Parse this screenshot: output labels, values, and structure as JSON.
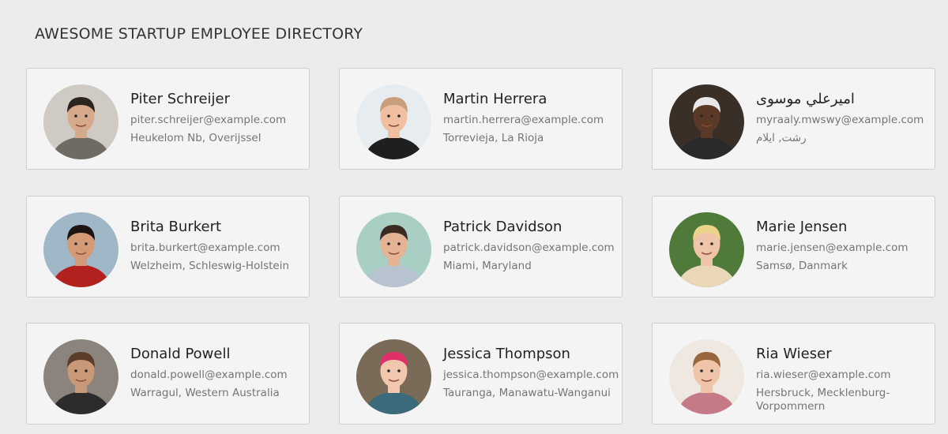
{
  "page": {
    "title": "AWESOME STARTUP EMPLOYEE DIRECTORY"
  },
  "employees": [
    {
      "name": "Piter Schreijer",
      "email": "piter.schreijer@example.com",
      "location": "Heukelom Nb, Overijssel",
      "avatar": {
        "bg": "#cfcac4",
        "skin": "#d6a98a",
        "hair": "#2b241f",
        "shirt": "#6f6a64"
      }
    },
    {
      "name": "Martin Herrera",
      "email": "martin.herrera@example.com",
      "location": "Torrevieja, La Rioja",
      "avatar": {
        "bg": "#e6ecef",
        "skin": "#efbfa0",
        "hair": "#c89f7c",
        "shirt": "#1f1f1f"
      }
    },
    {
      "name": "اميرعلي موسوی",
      "email": "myraaly.mwswy@example.com",
      "location": "رشت, ايلام",
      "avatar": {
        "bg": "#3a2f27",
        "skin": "#5a3a26",
        "hair": "#e8e8e8",
        "shirt": "#2a2a2a"
      }
    },
    {
      "name": "Brita Burkert",
      "email": "brita.burkert@example.com",
      "location": "Welzheim, Schleswig-Holstein",
      "avatar": {
        "bg": "#9fb7c7",
        "skin": "#d49a78",
        "hair": "#1c1410",
        "shirt": "#b3211f"
      }
    },
    {
      "name": "Patrick Davidson",
      "email": "patrick.davidson@example.com",
      "location": "Miami, Maryland",
      "avatar": {
        "bg": "#a9cfc5",
        "skin": "#e3b394",
        "hair": "#3a2a1f",
        "shirt": "#b7c3cf"
      }
    },
    {
      "name": "Marie Jensen",
      "email": "marie.jensen@example.com",
      "location": "Samsø, Danmark",
      "avatar": {
        "bg": "#4f7a3a",
        "skin": "#f0c4a8",
        "hair": "#ecd38a",
        "shirt": "#e9d7b8"
      }
    },
    {
      "name": "Donald Powell",
      "email": "donald.powell@example.com",
      "location": "Warragul, Western Australia",
      "avatar": {
        "bg": "#8a847c",
        "skin": "#c99876",
        "hair": "#5a3d2a",
        "shirt": "#2c2c2c"
      }
    },
    {
      "name": "Jessica Thompson",
      "email": "jessica.thompson@example.com",
      "location": "Tauranga, Manawatu-Wanganui",
      "avatar": {
        "bg": "#7a6a58",
        "skin": "#f1c7ae",
        "hair": "#e0306a",
        "shirt": "#3b6a7a"
      }
    },
    {
      "name": "Ria Wieser",
      "email": "ria.wieser@example.com",
      "location": "Hersbruck, Mecklenburg-Vorpommern",
      "avatar": {
        "bg": "#efe8e1",
        "skin": "#efc4a8",
        "hair": "#9a6640",
        "shirt": "#c57a88"
      }
    }
  ]
}
